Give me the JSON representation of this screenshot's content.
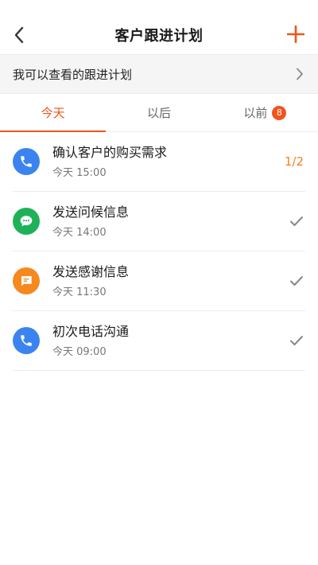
{
  "header": {
    "title": "客户跟进计划",
    "back_icon": "chevron-left-icon",
    "add_icon": "plus-icon"
  },
  "plan_row": {
    "label": "我可以查看的跟进计划",
    "icon": "chevron-right-icon"
  },
  "tabs": [
    {
      "label": "今天",
      "active": true
    },
    {
      "label": "以后",
      "active": false
    },
    {
      "label": "以前",
      "active": false,
      "badge": "8"
    }
  ],
  "items": [
    {
      "title": "确认客户的购买需求",
      "time": "今天 15:00",
      "icon": "phone-icon",
      "color": "#3b84f0",
      "status": "1/2"
    },
    {
      "title": "发送问候信息",
      "time": "今天 14:00",
      "icon": "wechat-icon",
      "color": "#1fb15a",
      "status": "check"
    },
    {
      "title": "发送感谢信息",
      "time": "今天 11:30",
      "icon": "message-icon",
      "color": "#f5891f",
      "status": "check"
    },
    {
      "title": "初次电话沟通",
      "time": "今天 09:00",
      "icon": "phone-icon",
      "color": "#3b84f0",
      "status": "check"
    }
  ],
  "colors": {
    "accent": "#f0541e",
    "progress": "#f0821e"
  }
}
